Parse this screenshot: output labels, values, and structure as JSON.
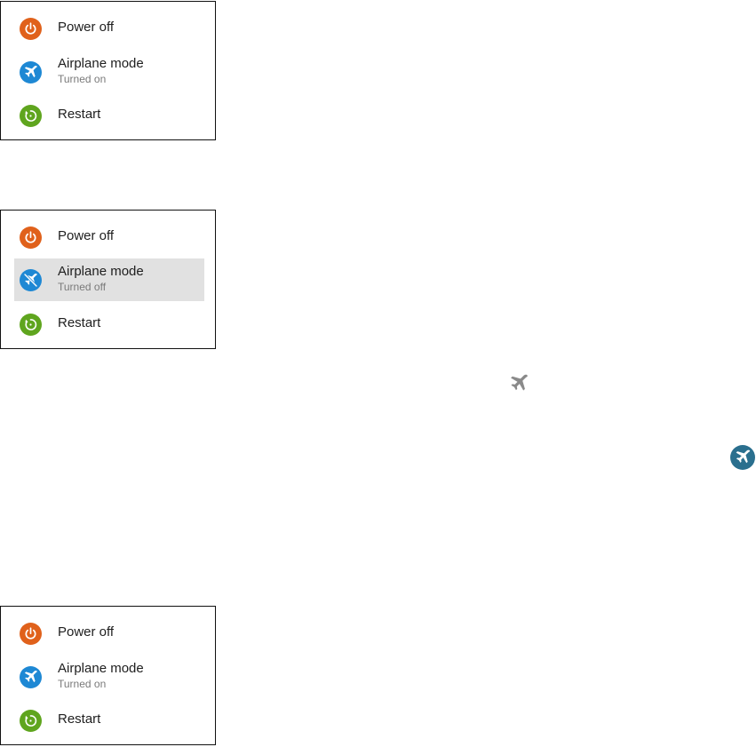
{
  "colors": {
    "power": "#e0611b",
    "airplane": "#1e88d4",
    "restart": "#5fa51e",
    "highlight": "#e1e1e1",
    "status_icon": "#8a8a8a",
    "quick_setting": "#2a6f8e"
  },
  "menus": [
    {
      "power_label": "Power off",
      "airplane_label": "Airplane mode",
      "airplane_status": "Turned on",
      "restart_label": "Restart"
    },
    {
      "power_label": "Power off",
      "airplane_label": "Airplane mode",
      "airplane_status": "Turned off",
      "restart_label": "Restart"
    },
    {
      "power_label": "Power off",
      "airplane_label": "Airplane mode",
      "airplane_status": "Turned on",
      "restart_label": "Restart"
    }
  ],
  "icons": {
    "power": "power-icon",
    "airplane_on": "airplane-icon",
    "airplane_off": "airplane-off-icon",
    "restart": "restart-icon",
    "status_bar": "airplane-status-icon",
    "quick_setting": "airplane-quick-setting-icon"
  }
}
